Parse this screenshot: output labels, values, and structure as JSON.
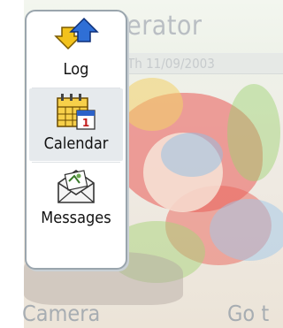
{
  "home": {
    "operator_name": "Iperator",
    "date": "Th 11/09/2003",
    "softkey_left": "Camera",
    "softkey_right": "Go t"
  },
  "toolbar": {
    "items": [
      {
        "label": "Log",
        "icon": "log-arrows-icon"
      },
      {
        "label": "Calendar",
        "icon": "calendar-icon"
      },
      {
        "label": "Messages",
        "icon": "messages-envelope-icon"
      }
    ],
    "selected": "Calendar"
  },
  "colors": {
    "toolbar_border": "#9aa5ad",
    "selected_bg": "#e6eaed",
    "softkey_text": "#a7adb2"
  }
}
